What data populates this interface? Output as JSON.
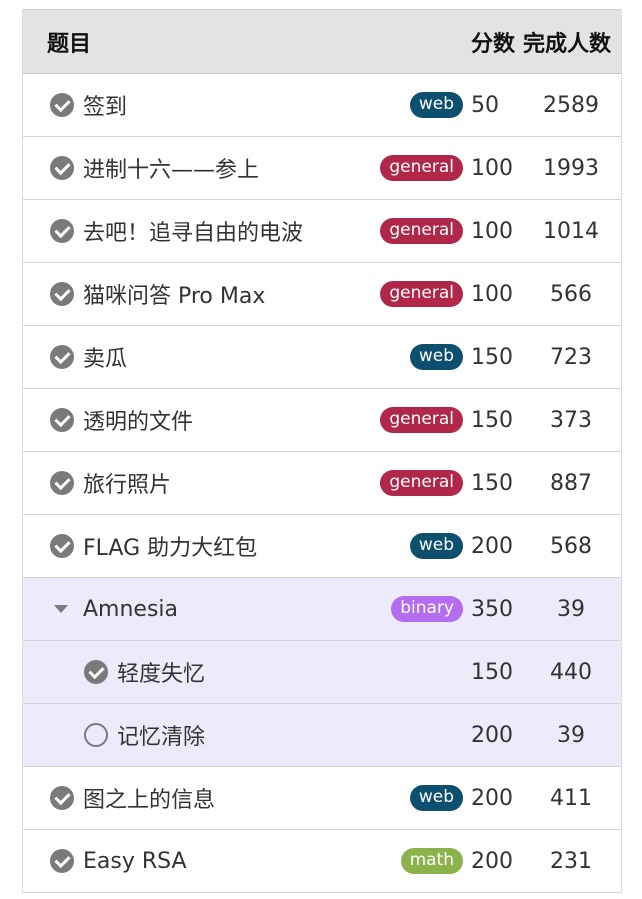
{
  "header": {
    "title": "题目",
    "score": "分数",
    "solved": "完成人数"
  },
  "tag_colors": {
    "web": "#0d4f6e",
    "general": "#b02749",
    "binary": "#b46cf0",
    "math": "#8bb34c"
  },
  "rows": [
    {
      "icon": "check-circle-icon",
      "name": "签到",
      "tag": "web",
      "score": "50",
      "solved": "2589"
    },
    {
      "icon": "check-circle-icon",
      "name": "进制十六——参上",
      "tag": "general",
      "score": "100",
      "solved": "1993"
    },
    {
      "icon": "check-circle-icon",
      "name": "去吧！追寻自由的电波",
      "tag": "general",
      "score": "100",
      "solved": "1014"
    },
    {
      "icon": "check-circle-icon",
      "name": "猫咪问答 Pro Max",
      "tag": "general",
      "score": "100",
      "solved": "566"
    },
    {
      "icon": "check-circle-icon",
      "name": "卖瓜",
      "tag": "web",
      "score": "150",
      "solved": "723"
    },
    {
      "icon": "check-circle-icon",
      "name": "透明的文件",
      "tag": "general",
      "score": "150",
      "solved": "373"
    },
    {
      "icon": "check-circle-icon",
      "name": "旅行照片",
      "tag": "general",
      "score": "150",
      "solved": "887"
    },
    {
      "icon": "check-circle-icon",
      "name": "FLAG 助力大红包",
      "tag": "web",
      "score": "200",
      "solved": "568"
    },
    {
      "icon": "caret-down-icon",
      "name": "Amnesia",
      "tag": "binary",
      "score": "350",
      "solved": "39",
      "kind": "group"
    },
    {
      "icon": "check-circle-icon",
      "name": "轻度失忆",
      "tag": "",
      "score": "150",
      "solved": "440",
      "kind": "sub"
    },
    {
      "icon": "empty-circle-icon",
      "name": "记忆清除",
      "tag": "",
      "score": "200",
      "solved": "39",
      "kind": "sub"
    },
    {
      "icon": "check-circle-icon",
      "name": "图之上的信息",
      "tag": "web",
      "score": "200",
      "solved": "411"
    },
    {
      "icon": "check-circle-icon",
      "name": "Easy RSA",
      "tag": "math",
      "score": "200",
      "solved": "231"
    }
  ]
}
